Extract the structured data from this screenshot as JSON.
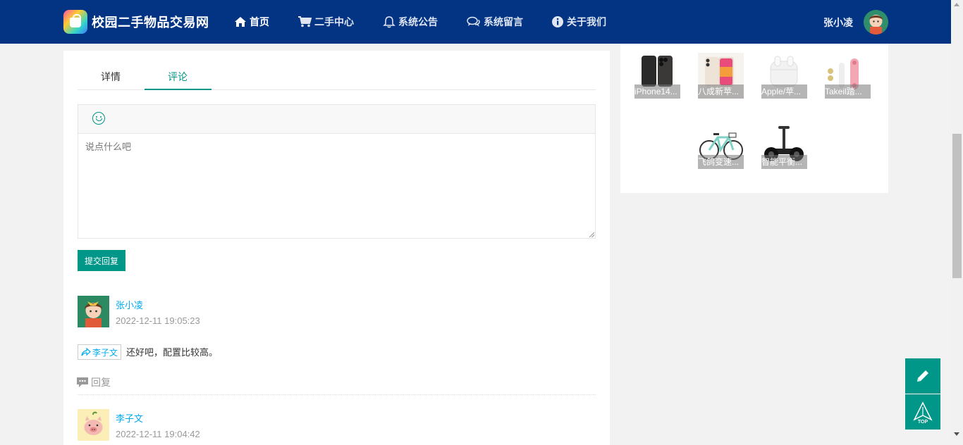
{
  "header": {
    "brand": "校园二手物品交易网",
    "nav": [
      {
        "label": "首页",
        "icon": "home-icon"
      },
      {
        "label": "二手中心",
        "icon": "cart-icon"
      },
      {
        "label": "系统公告",
        "icon": "bell-icon"
      },
      {
        "label": "系统留言",
        "icon": "chat-icon"
      },
      {
        "label": "关于我们",
        "icon": "info-icon"
      }
    ],
    "user_name": "张小凌"
  },
  "tabs": [
    {
      "label": "详情"
    },
    {
      "label": "评论"
    }
  ],
  "active_tab": "评论",
  "editor": {
    "placeholder": "说点什么吧",
    "submit_label": "提交回复"
  },
  "comments": [
    {
      "user": "张小凌",
      "time": "2022-12-11 19:05:23",
      "reply_to": "李子文",
      "text": "还好吧，配置比较高。",
      "reply_label": "回复"
    },
    {
      "user": "李子文",
      "time": "2022-12-11 19:04:42"
    }
  ],
  "products": [
    {
      "caption": "iPhone14..."
    },
    {
      "caption": "八成新苹..."
    },
    {
      "caption": "Apple/苹..."
    },
    {
      "caption": "Takeil踏..."
    },
    {
      "caption": "飞鸽变速..."
    },
    {
      "caption": "智能平衡..."
    }
  ],
  "floating": {
    "top_label": "TOP"
  },
  "colors": {
    "header_bg": "#033483",
    "accent": "#009688",
    "link": "#01aaed"
  }
}
